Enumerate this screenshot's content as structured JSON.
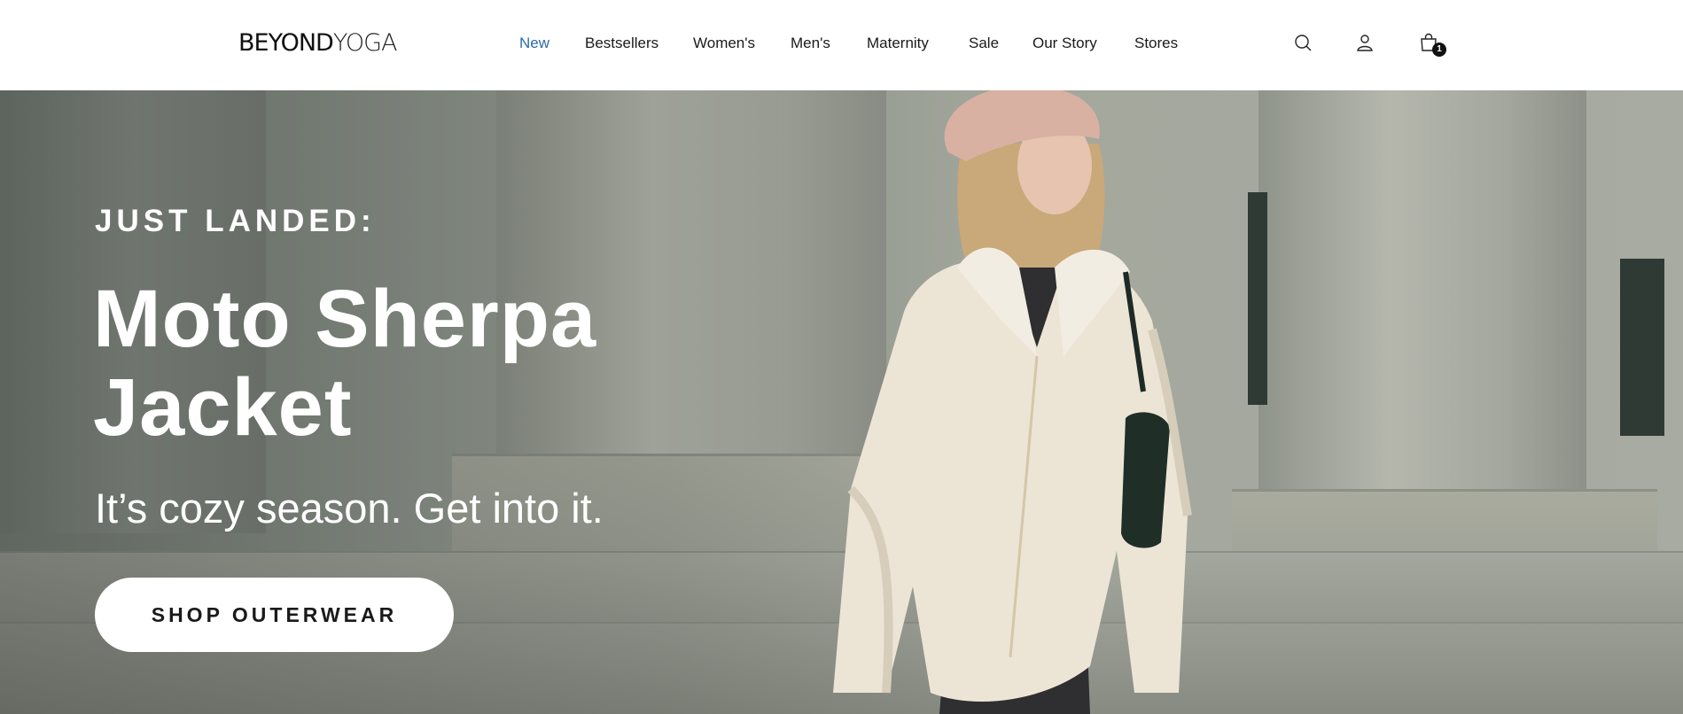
{
  "brand": {
    "logo_bold": "BEYOND",
    "logo_light": "YOGA"
  },
  "nav": {
    "items": [
      {
        "label": "New",
        "active": true
      },
      {
        "label": "Bestsellers"
      },
      {
        "label": "Women's"
      },
      {
        "label": "Men's"
      },
      {
        "label": "Maternity"
      },
      {
        "label": "Sale"
      },
      {
        "label": "Our Story"
      },
      {
        "label": "Stores"
      }
    ]
  },
  "header_icons": {
    "search": "search-icon",
    "account": "user-icon",
    "cart": "shopping-bag-icon",
    "cart_count": "1"
  },
  "hero": {
    "eyebrow": "JUST LANDED:",
    "headline_line1": "Moto Sherpa",
    "headline_line2": "Jacket",
    "subhead": "It’s cozy season. Get into it.",
    "cta_label": "SHOP OUTERWEAR"
  },
  "colors": {
    "nav_active": "#2d6aa8",
    "text": "#1a1a1a",
    "hero_text": "#ffffff",
    "cta_bg": "#ffffff"
  }
}
